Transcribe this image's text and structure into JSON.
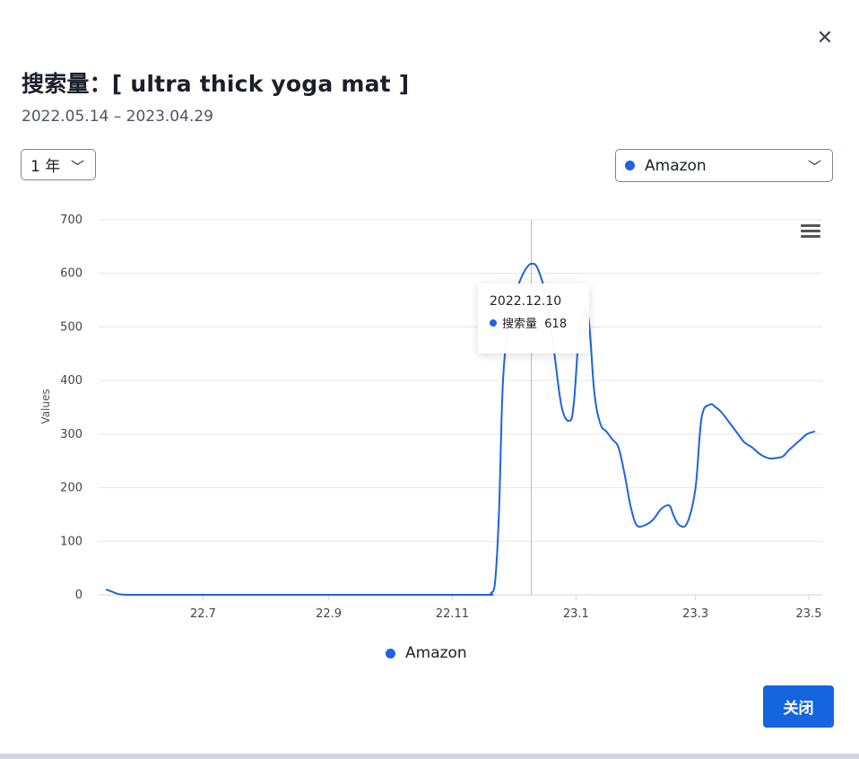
{
  "dialog": {
    "close_symbol": "✕",
    "title": "搜索量：[ ultra thick yoga mat ]",
    "date_range": "2022.05.14 – 2023.04.29",
    "range_select": {
      "value": "1 年",
      "chevron": "﹀"
    },
    "source_select": {
      "value": "Amazon",
      "chevron": "﹀"
    },
    "close_button": "关闭"
  },
  "tooltip": {
    "date": "2022.12.10",
    "series_label": "搜索量",
    "value": "618"
  },
  "colors": {
    "series": "#1f63e3",
    "grid": "#e6e6e6",
    "axis": "#ccd6eb",
    "button": "#1565e0"
  },
  "chart_data": {
    "type": "line",
    "ylabel": "Values",
    "ylim": [
      0,
      700
    ],
    "yticks": [
      "0",
      "100",
      "200",
      "300",
      "400",
      "500",
      "600",
      "700"
    ],
    "xticks": [
      "22.7",
      "22.9",
      "22.11",
      "23.1",
      "23.3",
      "23.5"
    ],
    "x_start": "2022-05-14",
    "x_end": "2023-04-29",
    "legend": {
      "label": "Amazon",
      "position": "bottom-center"
    },
    "series": [
      {
        "name": "Amazon",
        "x": [
          "2022-05-14",
          "2022-05-17",
          "2022-05-21",
          "2022-05-28",
          "2022-06-25",
          "2022-08-27",
          "2022-10-29",
          "2022-11-19",
          "2022-11-20",
          "2022-11-22",
          "2022-11-24",
          "2022-11-26",
          "2022-11-29",
          "2022-12-03",
          "2022-12-06",
          "2022-12-08",
          "2022-12-10",
          "2022-12-13",
          "2022-12-17",
          "2022-12-21",
          "2022-12-25",
          "2022-12-29",
          "2022-12-31",
          "2023-01-03",
          "2023-01-07",
          "2023-01-10",
          "2023-01-13",
          "2023-01-16",
          "2023-01-19",
          "2023-01-22",
          "2023-01-25",
          "2023-01-28",
          "2023-01-31",
          "2023-02-04",
          "2023-02-08",
          "2023-02-12",
          "2023-02-16",
          "2023-02-18",
          "2023-02-21",
          "2023-02-25",
          "2023-03-01",
          "2023-03-04",
          "2023-03-08",
          "2023-03-11",
          "2023-03-14",
          "2023-03-18",
          "2023-03-22",
          "2023-03-25",
          "2023-03-29",
          "2023-04-02",
          "2023-04-06",
          "2023-04-09",
          "2023-04-13",
          "2023-04-16",
          "2023-04-19",
          "2023-04-22",
          "2023-04-25",
          "2023-04-29"
        ],
        "values": [
          10,
          6,
          1,
          0,
          0,
          0,
          0,
          0,
          3,
          20,
          150,
          400,
          500,
          570,
          600,
          612,
          618,
          610,
          560,
          460,
          350,
          325,
          360,
          500,
          520,
          380,
          320,
          305,
          290,
          275,
          225,
          165,
          130,
          130,
          140,
          160,
          167,
          150,
          130,
          135,
          200,
          330,
          355,
          350,
          340,
          320,
          300,
          285,
          275,
          262,
          255,
          255,
          258,
          270,
          280,
          290,
          300,
          305
        ]
      }
    ]
  }
}
